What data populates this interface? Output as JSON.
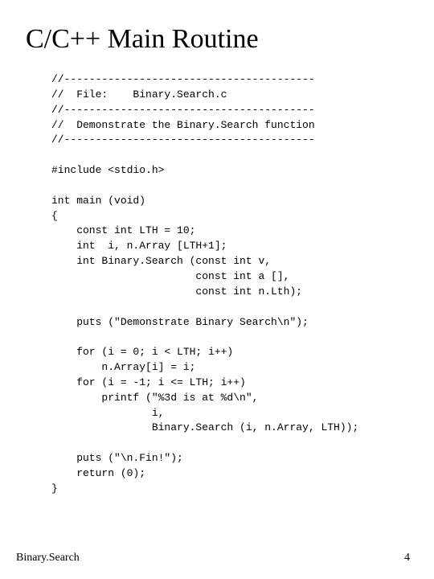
{
  "title": "C/C++ Main Routine",
  "code": "//----------------------------------------\n//  File:    Binary.Search.c\n//----------------------------------------\n//  Demonstrate the Binary.Search function\n//----------------------------------------\n\n#include <stdio.h>\n\nint main (void)\n{\n    const int LTH = 10;\n    int  i, n.Array [LTH+1];\n    int Binary.Search (const int v,\n                       const int a [],\n                       const int n.Lth);\n\n    puts (\"Demonstrate Binary Search\\n\");\n\n    for (i = 0; i < LTH; i++)\n        n.Array[i] = i;\n    for (i = -1; i <= LTH; i++)\n        printf (\"%3d is at %d\\n\",\n                i,\n                Binary.Search (i, n.Array, LTH));\n\n    puts (\"\\n.Fin!\");\n    return (0);\n}",
  "footer": {
    "left": "Binary.Search",
    "right": "4"
  }
}
